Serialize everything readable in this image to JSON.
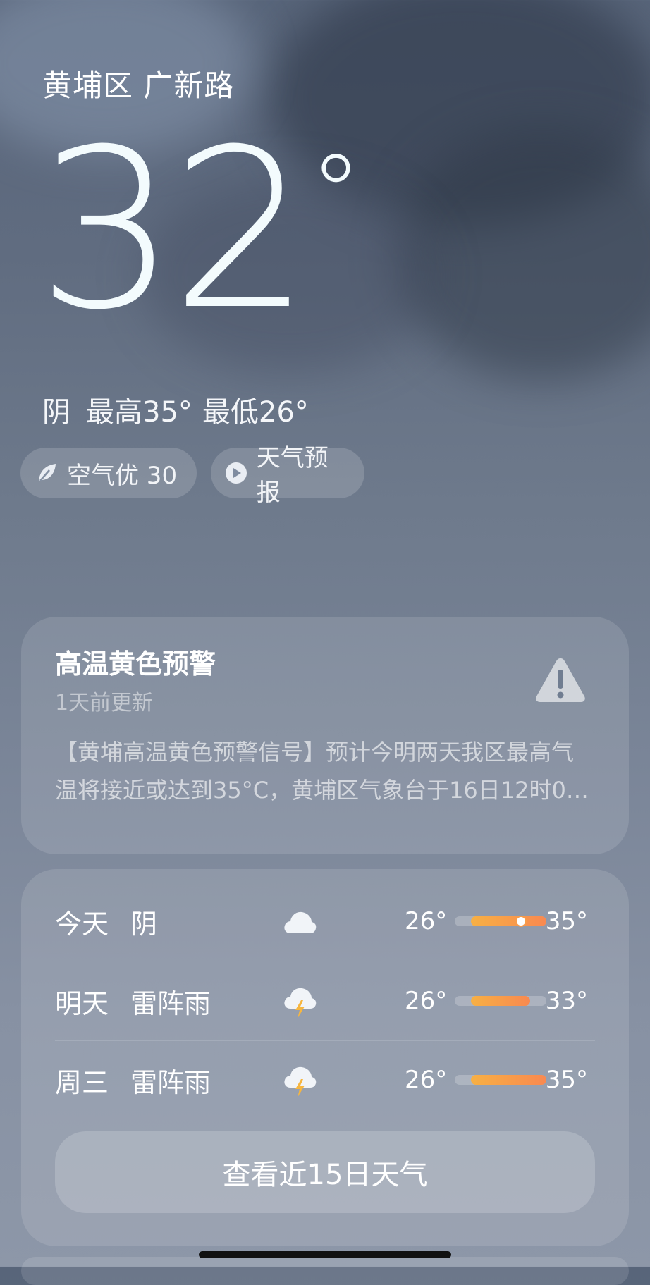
{
  "location": "黄埔区 广新路",
  "current": {
    "temperature": "32",
    "degree_symbol": "°",
    "condition": "阴",
    "high": "最高35°",
    "low": "最低26°"
  },
  "chips": {
    "air_quality": "空气优 30",
    "forecast_video": "天气预报"
  },
  "alert": {
    "title": "高温黄色预警",
    "updated": "1天前更新",
    "body_line1": "【黄埔高温黄色预警信号】预计今明两天我区最高气",
    "body_line2": "温将接近或达到35°C，黄埔区气象台于16日12时0…"
  },
  "forecast": [
    {
      "day": "今天",
      "condition": "阴",
      "icon": "cloud-icon",
      "low": "26°",
      "high": "35°",
      "range_start": 0.18,
      "range_end": 1.0,
      "current_marker": 0.72
    },
    {
      "day": "明天",
      "condition": "雷阵雨",
      "icon": "thunderstorm-icon",
      "low": "26°",
      "high": "33°",
      "range_start": 0.18,
      "range_end": 0.82
    },
    {
      "day": "周三",
      "condition": "雷阵雨",
      "icon": "thunderstorm-icon",
      "low": "26°",
      "high": "35°",
      "range_start": 0.18,
      "range_end": 1.0
    }
  ],
  "button_15day": "查看近15日天气",
  "colors": {
    "accent_orange": "#f98950",
    "accent_yellow": "#f7b044"
  }
}
